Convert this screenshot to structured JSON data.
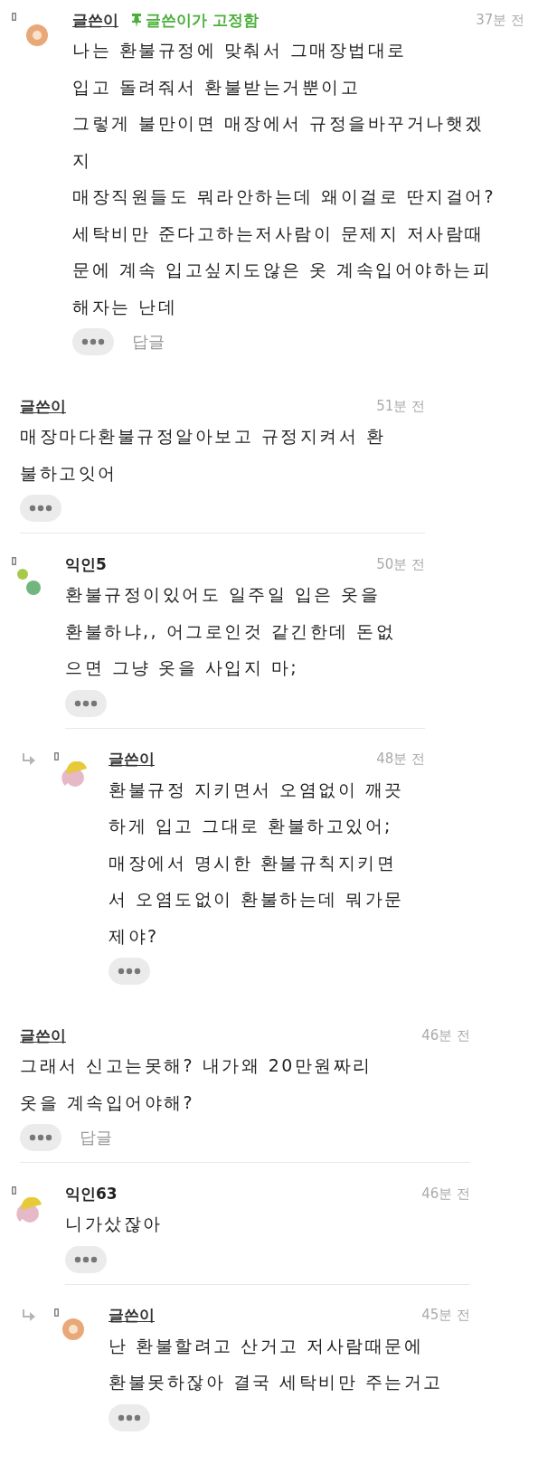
{
  "threads": [
    {
      "comments": [
        {
          "author": "글쓴이",
          "kind": "writer",
          "avatar": {
            "kind": "ring"
          },
          "pinned_label": "글쓴이가 고정함",
          "time": "37분 전",
          "body": "나는 환불규정에 맞춰서 그매장법대로\n입고 돌려줘서 환불받는거뿐이고\n그렇게 불만이면 매장에서 규정을바꾸거나햇겠\n지\n매장직원들도 뭐라안하는데 왜이걸로 딴지걸어?\n세탁비만 준다고하는저사람이 문제지 저사람때\n문에 계속 입고싶지도않은 옷 계속입어야하는피\n해자는 난데",
          "reply_label": "답글"
        }
      ]
    },
    {
      "comments": [
        {
          "author": "글쓴이",
          "kind": "writer",
          "time": "51분 전",
          "body": "매장마다환불규정알아보고 규정지켜서 환\n불하고잇어"
        },
        {
          "author": "익인5",
          "kind": "anon",
          "avatar": {
            "kind": "dots"
          },
          "time": "50분 전",
          "body": "환불규정이있어도 일주일 입은 옷을\n환불하냐,, 어그로인것 같긴한데 돈없\n으면 그냥 옷을 사입지 마;",
          "replies": [
            {
              "author": "글쓴이",
              "kind": "writer",
              "avatar": {
                "kind": "halves"
              },
              "time": "48분 전",
              "body": "환불규정 지키면서 오염없이 깨끗\n하게 입고 그대로 환불하고있어;\n매장에서 명시한 환불규칙지키면\n서 오염도없이 환불하는데 뭐가문\n제야?"
            }
          ]
        }
      ]
    },
    {
      "comments": [
        {
          "author": "글쓴이",
          "kind": "writer",
          "time": "46분 전",
          "body": "그래서 신고는못해? 내가왜 20만원짜리\n옷을 계속입어야해?",
          "reply_label": "답글"
        },
        {
          "author": "익인63",
          "kind": "anon",
          "avatar": {
            "kind": "halves"
          },
          "time": "46분 전",
          "body": "니가샀잖아",
          "replies": [
            {
              "author": "글쓴이",
              "kind": "writer",
              "avatar": {
                "kind": "ring"
              },
              "time": "45분 전",
              "body": "난 환불할려고 산거고 저사람때문에\n환불못하잖아 결국 세탁비만 주는거고"
            }
          ]
        }
      ]
    }
  ]
}
